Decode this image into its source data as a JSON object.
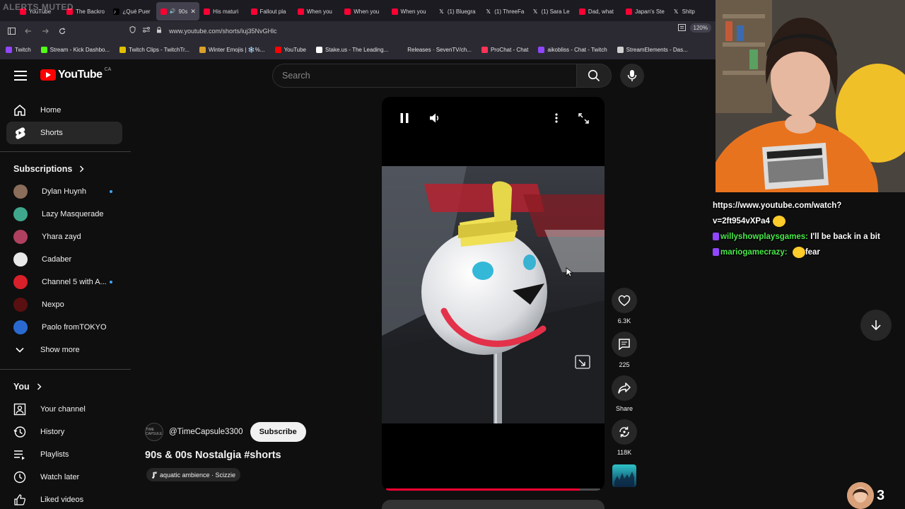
{
  "browser": {
    "overlay_text": "ALERTS MUTED",
    "tabs": [
      {
        "label": "YouTube",
        "fav": "yt"
      },
      {
        "label": "The Backro",
        "fav": "yt"
      },
      {
        "label": "¿Qué Puer",
        "fav": "tt"
      },
      {
        "label": "90s",
        "fav": "yt",
        "active": true
      },
      {
        "label": "His maturi",
        "fav": "yt"
      },
      {
        "label": "Fallout pla",
        "fav": "yt"
      },
      {
        "label": "When you",
        "fav": "yt"
      },
      {
        "label": "When you",
        "fav": "yt"
      },
      {
        "label": "When you",
        "fav": "yt"
      },
      {
        "label": "(1) Bluegra",
        "fav": "x"
      },
      {
        "label": "(1) ThreeFa",
        "fav": "x"
      },
      {
        "label": "(1) Sara Le",
        "fav": "x"
      },
      {
        "label": "Dad, what",
        "fav": "yt"
      },
      {
        "label": "Japan's Ste",
        "fav": "yt"
      },
      {
        "label": "Shitp",
        "fav": "x"
      }
    ],
    "url": "www.youtube.com/shorts/iuj35NvGHlc",
    "zoom": "120%",
    "bookmarks": [
      {
        "label": "Twitch",
        "color": "#9146ff"
      },
      {
        "label": "Stream - Kick Dashbo...",
        "color": "#53fc18"
      },
      {
        "label": "Twitch Clips - TwitchTr...",
        "color": "#e0c000"
      },
      {
        "label": "Winter Emojis | ❄️%...",
        "color": "#d9a12a"
      },
      {
        "label": "YouTube",
        "color": "#ff0000"
      },
      {
        "label": "Stake.us - The Leading...",
        "color": "#ffffff"
      },
      {
        "label": "Releases · SevenTV/ch...",
        "color": "#2b2a33"
      },
      {
        "label": "ProChat - Chat",
        "color": "#ff3355"
      },
      {
        "label": "aikobliss - Chat - Twitch",
        "color": "#9146ff"
      },
      {
        "label": "StreamElements - Das...",
        "color": "#d0d0d0"
      }
    ]
  },
  "youtube": {
    "logo_text": "YouTube",
    "country": "CA",
    "search_placeholder": "Search",
    "sidebar": {
      "home": "Home",
      "shorts": "Shorts",
      "subscriptions_header": "Subscriptions",
      "subscriptions": [
        {
          "name": "Dylan Huynh",
          "color": "#8a6d5a",
          "new": true
        },
        {
          "name": "Lazy Masquerade",
          "color": "#3fa88c",
          "new": false
        },
        {
          "name": "Yhara zayd",
          "color": "#b04060",
          "new": false
        },
        {
          "name": "Cadaber",
          "color": "#e8e8e8",
          "new": false
        },
        {
          "name": "Channel 5 with A...",
          "color": "#d8202a",
          "new": true
        },
        {
          "name": "Nexpo",
          "color": "#5a1010",
          "new": false
        },
        {
          "name": "Paolo fromTOKYO",
          "color": "#2a6ad0",
          "new": false
        }
      ],
      "show_more": "Show more",
      "you_header": "You",
      "you_items": [
        "Your channel",
        "History",
        "Playlists",
        "Watch later",
        "Liked videos"
      ]
    },
    "short": {
      "channel_handle": "@TimeCapsule3300",
      "channel_avatar_text": "TIME CAPSULE",
      "subscribe": "Subscribe",
      "title": "90s & 00s Nostalgia #shorts",
      "music": "aquatic ambience · Scizzie",
      "likes": "6.3K",
      "comments": "225",
      "share": "Share",
      "remix": "118K",
      "progress": 0.9
    }
  },
  "stream_overlay": {
    "chat": [
      {
        "user": "",
        "text": "https://www.youtube.com/watch?"
      },
      {
        "user": "",
        "text": "v=2ft954vXPa4"
      },
      {
        "user": "willyshowplaysgames:",
        "text": "I'll be back in a bit"
      },
      {
        "user": "mariogamecrazy:",
        "text": "fear"
      }
    ],
    "viewer_count": "3"
  }
}
